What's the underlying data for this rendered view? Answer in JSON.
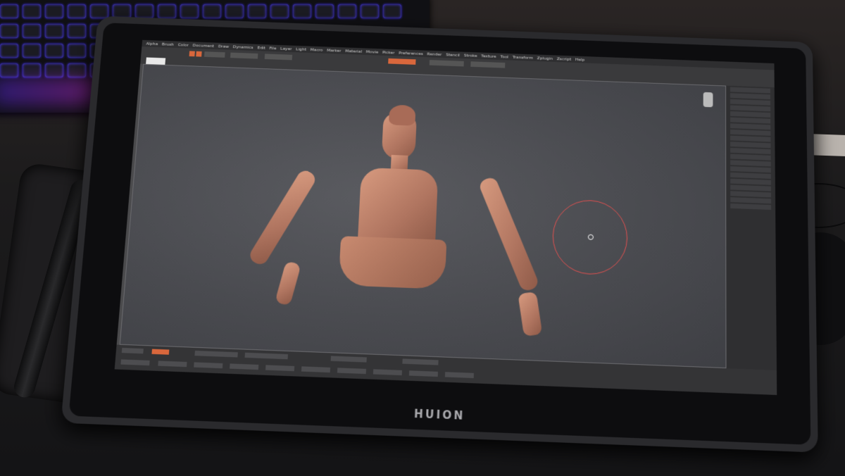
{
  "scene": {
    "tablet_brand": "HUION"
  },
  "app": {
    "menu": [
      "Alpha",
      "Brush",
      "Color",
      "Document",
      "Draw",
      "Dynamics",
      "Edit",
      "File",
      "Layer",
      "Light",
      "Macro",
      "Marker",
      "Material",
      "Movie",
      "Picker",
      "Preferences",
      "Render",
      "Stencil",
      "Stroke",
      "Texture",
      "Tool",
      "Transform",
      "Zplugin",
      "Zscript",
      "Help"
    ],
    "colors": {
      "accent": "#d9673c",
      "cursor_ring": "#e0504f",
      "model_clay": "#c08670",
      "canvas_bg": "#4a4b50"
    }
  }
}
